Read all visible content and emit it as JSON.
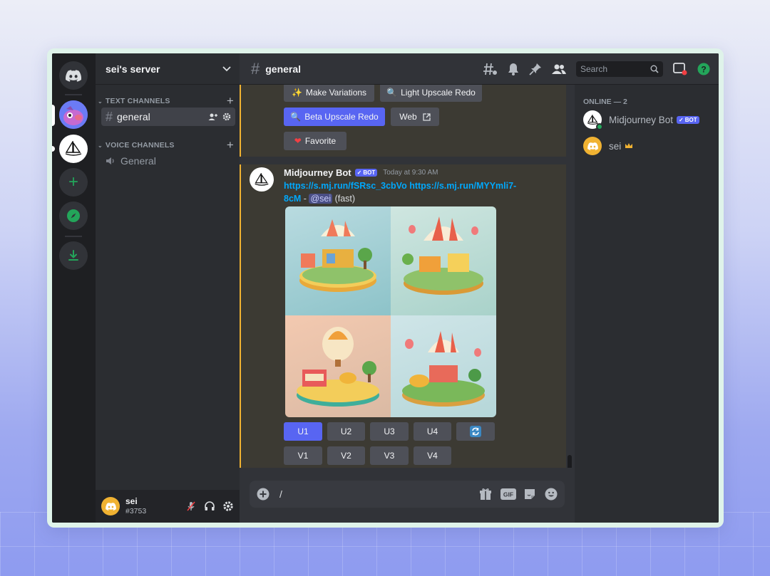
{
  "server": {
    "name": "sei's server"
  },
  "categories": {
    "text": "TEXT CHANNELS",
    "voice": "VOICE CHANNELS"
  },
  "channels": {
    "text_general": "general",
    "voice_general": "General"
  },
  "topbar": {
    "channel": "general",
    "search_placeholder": "Search"
  },
  "buttons": {
    "make_variations": "Make Variations",
    "light_upscale_redo": "Light Upscale Redo",
    "beta_upscale_redo": "Beta Upscale Redo",
    "web": "Web",
    "favorite": "Favorite",
    "u1": "U1",
    "u2": "U2",
    "u3": "U3",
    "u4": "U4",
    "v1": "V1",
    "v2": "V2",
    "v3": "V3",
    "v4": "V4"
  },
  "message": {
    "author": "Midjourney Bot",
    "bot_tag": "BOT",
    "timestamp": "Today at 9:30 AM",
    "link1": "https://s.mj.run/fSRsc_3cbVo",
    "link2a": "https://s.mj.run/MYYmli7-",
    "link2b": "8cM",
    "dash": " - ",
    "mention": "@sei",
    "speed": "(fast)"
  },
  "composer": {
    "value": "/"
  },
  "user": {
    "name": "sei",
    "tag": "#3753"
  },
  "members": {
    "header": "ONLINE — 2",
    "list": [
      {
        "name": "Midjourney Bot",
        "tag": "BOT"
      },
      {
        "name": "sei"
      }
    ]
  },
  "icons": {
    "discord_home": "discord-logo-icon",
    "add_server": "plus-icon",
    "explore": "compass-icon",
    "download": "download-icon",
    "threads": "threads-icon",
    "bell": "bell-icon",
    "pin": "pin-icon",
    "members": "members-icon",
    "inbox": "inbox-icon",
    "help": "help-icon"
  },
  "colors": {
    "blurple": "#5865f2",
    "mention_highlight": "#f0b232",
    "link": "#00a8fc",
    "online": "#23a55a",
    "help_green": "#23a55a"
  }
}
